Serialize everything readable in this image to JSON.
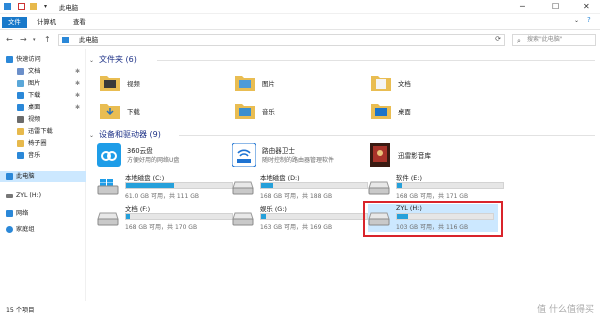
{
  "window": {
    "title": "此电脑",
    "controls": {
      "minimize": "─",
      "maximize": "☐",
      "close": "✕"
    }
  },
  "ribbon": {
    "tabs": [
      "文件",
      "计算机",
      "查看"
    ]
  },
  "address": {
    "back": "←",
    "forward": "→",
    "up": "↑",
    "path": "此电脑",
    "refresh": "⟳",
    "search_placeholder": "搜索\"此电脑\""
  },
  "sidebar": {
    "items": [
      {
        "label": "快速访问",
        "icon": "star-icon",
        "color": "#2b88d8",
        "pinned": false
      },
      {
        "label": "文档",
        "icon": "document-icon",
        "color": "#6b8fc9",
        "pinned": true
      },
      {
        "label": "图片",
        "icon": "picture-icon",
        "color": "#5aa7d9",
        "pinned": true
      },
      {
        "label": "下载",
        "icon": "download-icon",
        "color": "#2b88d8",
        "pinned": true
      },
      {
        "label": "桌面",
        "icon": "desktop-icon",
        "color": "#2b88d8",
        "pinned": true
      },
      {
        "label": "视频",
        "icon": "video-icon",
        "color": "#6b6b6b",
        "pinned": false
      },
      {
        "label": "迅雷下载",
        "icon": "folder-icon",
        "color": "#e7b94c",
        "pinned": false
      },
      {
        "label": "椅子圈",
        "icon": "folder-icon",
        "color": "#e7b94c",
        "pinned": false
      },
      {
        "label": "音乐",
        "icon": "music-icon",
        "color": "#2b88d8",
        "pinned": false
      },
      {
        "label": "此电脑",
        "icon": "computer-icon",
        "color": "#2b88d8",
        "pinned": false
      },
      {
        "label": "ZYL (H:)",
        "icon": "usb-drive-icon",
        "color": "#777777",
        "pinned": false
      },
      {
        "label": "网络",
        "icon": "network-icon",
        "color": "#2b88d8",
        "pinned": false
      },
      {
        "label": "家庭组",
        "icon": "homegroup-icon",
        "color": "#2b88d8",
        "pinned": false
      }
    ],
    "pin_glyph": "✱"
  },
  "folders": {
    "title": "文件夹 (6)",
    "items": [
      {
        "label": "视频",
        "icon": "videos-folder-icon"
      },
      {
        "label": "图片",
        "icon": "pictures-folder-icon"
      },
      {
        "label": "文档",
        "icon": "documents-folder-icon"
      },
      {
        "label": "下载",
        "icon": "downloads-folder-icon"
      },
      {
        "label": "音乐",
        "icon": "music-folder-icon"
      },
      {
        "label": "桌面",
        "icon": "desktop-folder-icon"
      }
    ]
  },
  "devices": {
    "title": "设备和驱动器 (9)",
    "apps": [
      {
        "name": "360云盘",
        "sub": "方便好用的网络U盘",
        "icon": "cloud-drive-icon"
      },
      {
        "name": "路由器卫士",
        "sub": "随时控制的路由器管理软件",
        "icon": "router-icon"
      },
      {
        "name": "迅雷影音库",
        "sub": "",
        "icon": "media-library-icon"
      }
    ],
    "drives": [
      {
        "name": "本地磁盘 (C:)",
        "size": "61.0 GB 可用，共 111 GB",
        "used_fraction": 0.45
      },
      {
        "name": "本地磁盘 (D:)",
        "size": "168 GB 可用，共 188 GB",
        "used_fraction": 0.11
      },
      {
        "name": "软件 (E:)",
        "size": "168 GB 可用，共 171 GB",
        "used_fraction": 0.05
      },
      {
        "name": "文档 (F:)",
        "size": "168 GB 可用，共 170 GB",
        "used_fraction": 0.04
      },
      {
        "name": "娱乐 (G:)",
        "size": "163 GB 可用，共 169 GB",
        "used_fraction": 0.05
      },
      {
        "name": "ZYL (H:)",
        "size": "103 GB 可用，共 116 GB",
        "used_fraction": 0.11
      }
    ]
  },
  "status": {
    "count": "15 个项目"
  },
  "watermark": "值 什么值得买",
  "colors": {
    "accent": "#1979ca",
    "bar": "#26a0da",
    "highlight": "#d9242b",
    "section": "#1e3287"
  }
}
